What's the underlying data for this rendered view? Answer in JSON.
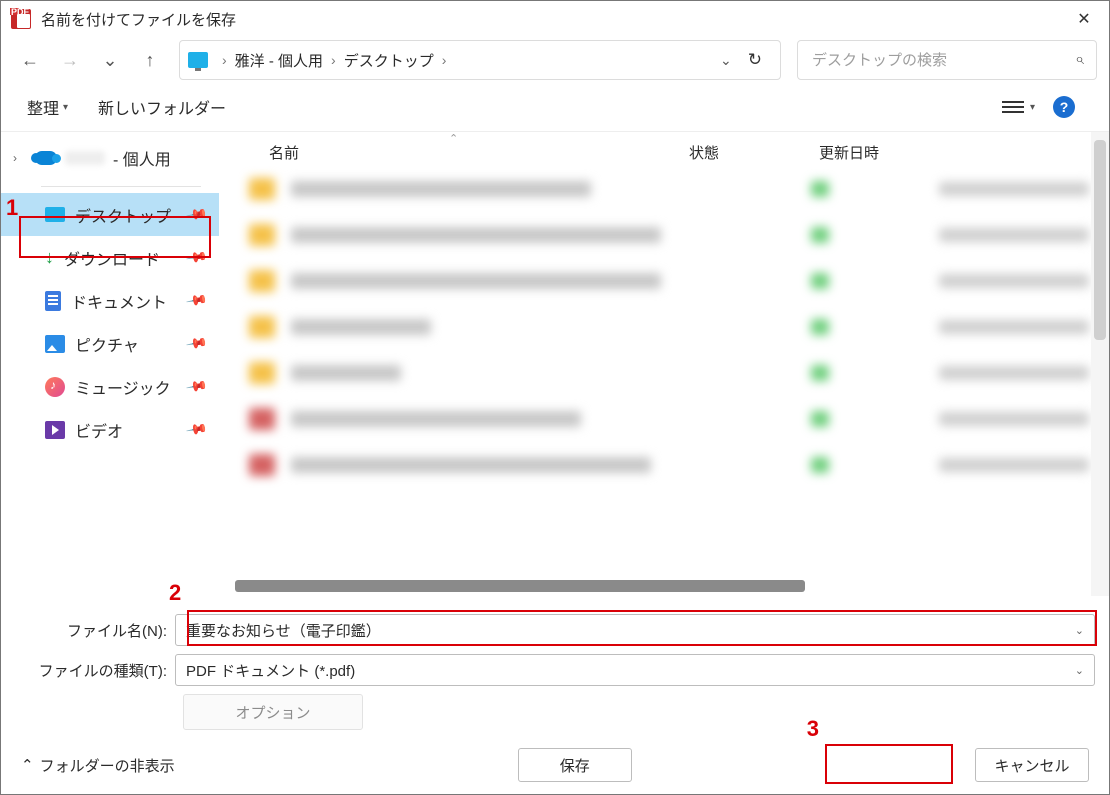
{
  "window": {
    "title": "名前を付けてファイルを保存"
  },
  "breadcrumb": {
    "seg1": "雅洋 - 個人用",
    "seg2": "デスクトップ"
  },
  "search": {
    "placeholder": "デスクトップの検索"
  },
  "toolbar": {
    "organize": "整理",
    "newfolder": "新しいフォルダー"
  },
  "tree": {
    "root": "- 個人用",
    "items": [
      {
        "label": "デスクトップ",
        "icon": "monitor",
        "selected": true
      },
      {
        "label": "ダウンロード",
        "icon": "download",
        "selected": false
      },
      {
        "label": "ドキュメント",
        "icon": "document",
        "selected": false
      },
      {
        "label": "ピクチャ",
        "icon": "picture",
        "selected": false
      },
      {
        "label": "ミュージック",
        "icon": "music",
        "selected": false
      },
      {
        "label": "ビデオ",
        "icon": "video",
        "selected": false
      }
    ]
  },
  "columns": {
    "name": "名前",
    "status": "状態",
    "date": "更新日時"
  },
  "fields": {
    "filename_label": "ファイル名(N):",
    "filename_value": "重要なお知らせ（電子印鑑）",
    "filetype_label": "ファイルの種類(T):",
    "filetype_value": "PDF ドキュメント (*.pdf)",
    "options": "オプション"
  },
  "footer": {
    "toggle": "フォルダーの非表示",
    "save": "保存",
    "cancel": "キャンセル"
  },
  "annotations": {
    "a1": "1",
    "a2": "2",
    "a3": "3"
  }
}
